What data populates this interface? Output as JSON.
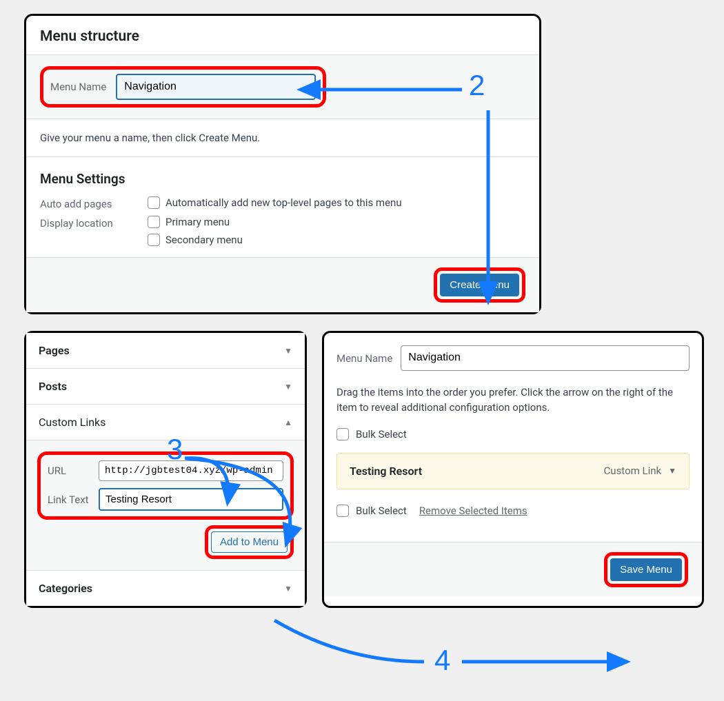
{
  "top": {
    "title": "Menu structure",
    "name_label": "Menu Name",
    "name_value": "Navigation",
    "help": "Give your menu a name, then click Create Menu.",
    "settings_title": "Menu Settings",
    "auto_add_label": "Auto add pages",
    "auto_add_text": "Automatically add new top-level pages to this menu",
    "display_loc_label": "Display location",
    "primary": "Primary menu",
    "secondary": "Secondary menu",
    "create_btn": "Create Menu"
  },
  "acc": {
    "pages": "Pages",
    "posts": "Posts",
    "custom": "Custom Links",
    "url_label": "URL",
    "url_value": "http://jgbtest04.xyz/wp-admin",
    "text_label": "Link Text",
    "text_value": "Testing Resort",
    "add_btn": "Add to Menu",
    "categories": "Categories"
  },
  "right": {
    "name_label": "Menu Name",
    "name_value": "Navigation",
    "instruction": "Drag the items into the order you prefer. Click the arrow on the right of the item to reveal additional configuration options.",
    "bulk": "Bulk Select",
    "item_title": "Testing Resort",
    "item_type": "Custom Link",
    "remove": "Remove Selected Items",
    "save_btn": "Save Menu"
  },
  "ann": {
    "n2": "2",
    "n3": "3",
    "n4": "4"
  }
}
